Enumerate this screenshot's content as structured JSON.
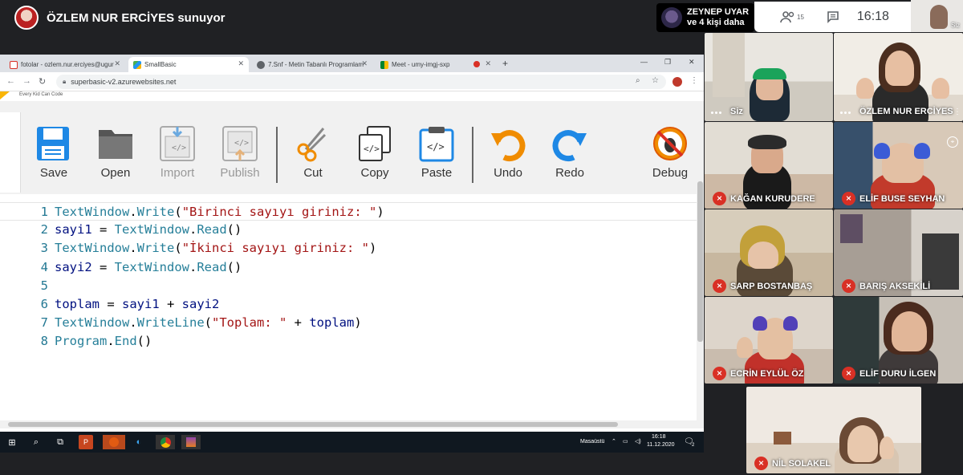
{
  "meet": {
    "presenter_label": "ÖZLEM NUR ERCİYES sunuyor",
    "active_speaker": {
      "name": "ZEYNEP UYAR",
      "others": "ve 4 kişi daha"
    },
    "people_count": "15",
    "time": "16:18",
    "self_label": "Siz",
    "participants": [
      {
        "name": "Siz",
        "muted": false
      },
      {
        "name": "ÖZLEM NUR ERCİYES",
        "muted": false
      },
      {
        "name": "KAĞAN KURUDERE",
        "muted": true
      },
      {
        "name": "ELİF BUSE SEYHAN",
        "muted": true
      },
      {
        "name": "SARP BOSTANBAŞ",
        "muted": true
      },
      {
        "name": "BARIŞ AKSEKİLİ",
        "muted": true
      },
      {
        "name": "ECRİN EYLÜL ÖZ",
        "muted": true
      },
      {
        "name": "ELİF DURU İLGEN",
        "muted": true
      },
      {
        "name": "NİL SOLAKEL",
        "muted": true
      }
    ]
  },
  "browser": {
    "tabs": [
      {
        "title": "fotolar - ozlem.nur.erciyes@ugur",
        "icon": "gmail-icon"
      },
      {
        "title": "SmallBasic",
        "icon": "smallbasic-icon",
        "active": true
      },
      {
        "title": "7.Snf - Metin Tabanlı Programlam",
        "icon": "globe-icon"
      },
      {
        "title": "Meet - umy-imgj-sxp",
        "icon": "meet-icon"
      }
    ],
    "url": "superbasic-v2.azurewebsites.net",
    "logo_tagline": "Every Kid Can Code"
  },
  "toolbar": {
    "buttons": [
      {
        "label": "Save",
        "enabled": true,
        "icon": "save-icon"
      },
      {
        "label": "Open",
        "enabled": true,
        "icon": "folder-icon"
      },
      {
        "label": "Import",
        "enabled": false,
        "icon": "import-icon"
      },
      {
        "label": "Publish",
        "enabled": false,
        "icon": "publish-icon"
      },
      {
        "label": "Cut",
        "enabled": true,
        "icon": "scissors-icon"
      },
      {
        "label": "Copy",
        "enabled": true,
        "icon": "copy-icon"
      },
      {
        "label": "Paste",
        "enabled": true,
        "icon": "paste-icon"
      },
      {
        "label": "Undo",
        "enabled": true,
        "icon": "undo-icon"
      },
      {
        "label": "Redo",
        "enabled": true,
        "icon": "redo-icon"
      },
      {
        "label": "Debug",
        "enabled": true,
        "icon": "bug-icon"
      }
    ]
  },
  "editor": {
    "lines": [
      {
        "n": "1",
        "tokens": [
          [
            "obj",
            "TextWindow"
          ],
          [
            "pun",
            "."
          ],
          [
            "obj",
            "Write"
          ],
          [
            "pun",
            "("
          ],
          [
            "str",
            "\"Birinci sayıyı giriniz: \""
          ],
          [
            "pun",
            ")"
          ]
        ]
      },
      {
        "n": "2",
        "tokens": [
          [
            "var",
            "sayi1"
          ],
          [
            "pun",
            " = "
          ],
          [
            "obj",
            "TextWindow"
          ],
          [
            "pun",
            "."
          ],
          [
            "obj",
            "Read"
          ],
          [
            "pun",
            "()"
          ]
        ]
      },
      {
        "n": "3",
        "tokens": [
          [
            "obj",
            "TextWindow"
          ],
          [
            "pun",
            "."
          ],
          [
            "obj",
            "Write"
          ],
          [
            "pun",
            "("
          ],
          [
            "str",
            "\"İkinci sayıyı giriniz: \""
          ],
          [
            "pun",
            ")"
          ]
        ]
      },
      {
        "n": "4",
        "tokens": [
          [
            "var",
            "sayi2"
          ],
          [
            "pun",
            " = "
          ],
          [
            "obj",
            "TextWindow"
          ],
          [
            "pun",
            "."
          ],
          [
            "obj",
            "Read"
          ],
          [
            "pun",
            "()"
          ]
        ]
      },
      {
        "n": "5",
        "tokens": []
      },
      {
        "n": "6",
        "tokens": [
          [
            "var",
            "toplam"
          ],
          [
            "pun",
            " = "
          ],
          [
            "var",
            "sayi1"
          ],
          [
            "pun",
            " + "
          ],
          [
            "var",
            "sayi2"
          ]
        ]
      },
      {
        "n": "7",
        "tokens": [
          [
            "obj",
            "TextWindow"
          ],
          [
            "pun",
            "."
          ],
          [
            "obj",
            "WriteLine"
          ],
          [
            "pun",
            "("
          ],
          [
            "str",
            "\"Toplam: \""
          ],
          [
            "pun",
            " + "
          ],
          [
            "var",
            "toplam"
          ],
          [
            "pun",
            ")"
          ]
        ]
      },
      {
        "n": "8",
        "tokens": [
          [
            "obj",
            "Program"
          ],
          [
            "pun",
            "."
          ],
          [
            "obj",
            "End"
          ],
          [
            "pun",
            "()"
          ]
        ]
      }
    ]
  },
  "taskbar": {
    "desktop_label": "Masaüstü",
    "time": "16:18",
    "date": "11.12.2020",
    "notifications": "2"
  }
}
